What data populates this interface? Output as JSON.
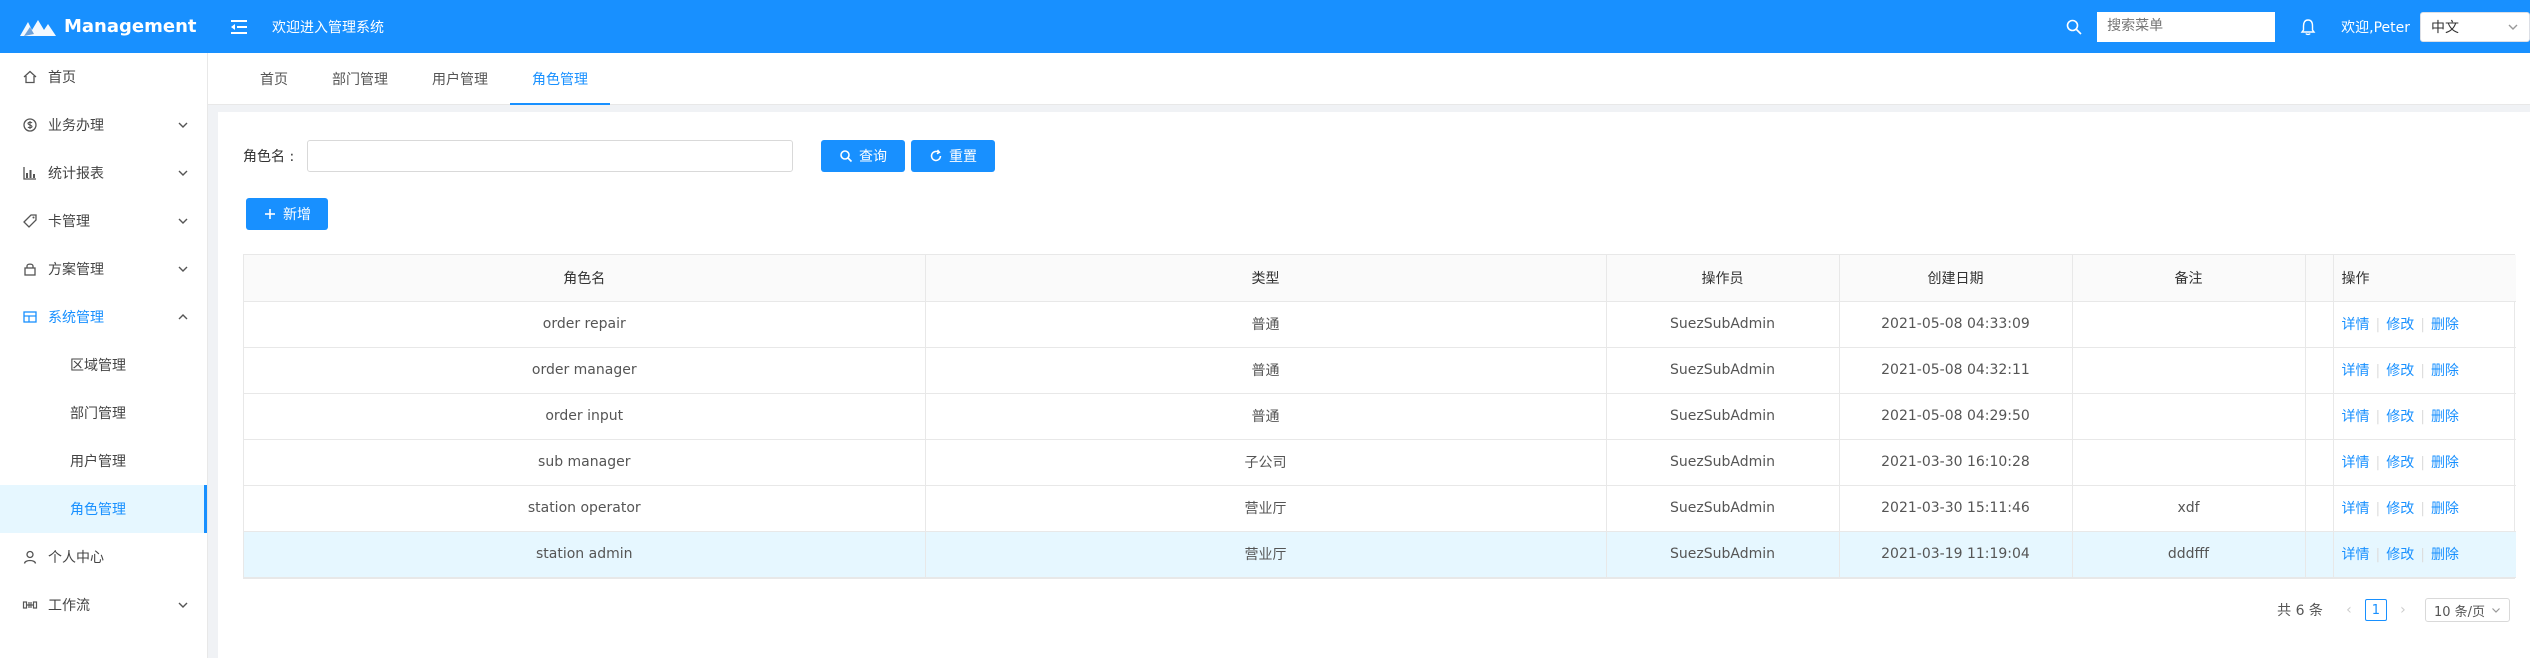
{
  "header": {
    "brand": "Management",
    "welcome_system": "欢迎进入管理系统",
    "search_placeholder": "搜索菜单",
    "user_greeting": "欢迎,Peter",
    "language": "中文"
  },
  "sidebar": {
    "items": [
      {
        "label": "首页",
        "icon": "home-icon"
      },
      {
        "label": "业务办理",
        "icon": "dollar-icon",
        "expandable": true
      },
      {
        "label": "统计报表",
        "icon": "chart-icon",
        "expandable": true
      },
      {
        "label": "卡管理",
        "icon": "card-icon",
        "expandable": true
      },
      {
        "label": "方案管理",
        "icon": "lock-icon",
        "expandable": true
      },
      {
        "label": "系统管理",
        "icon": "system-icon",
        "expandable": true,
        "expanded": true
      },
      {
        "label": "个人中心",
        "icon": "user-icon"
      },
      {
        "label": "工作流",
        "icon": "workflow-icon",
        "expandable": true
      }
    ],
    "sub_items": [
      "区域管理",
      "部门管理",
      "用户管理",
      "角色管理"
    ],
    "selected_sub": "角色管理"
  },
  "tabs": [
    "首页",
    "部门管理",
    "用户管理",
    "角色管理"
  ],
  "active_tab": "角色管理",
  "filter": {
    "label": "角色名 :",
    "value": "",
    "query_label": "查询",
    "reset_label": "重置",
    "add_label": "新增"
  },
  "table": {
    "columns": [
      "角色名",
      "类型",
      "操作员",
      "创建日期",
      "备注",
      "",
      "操作"
    ],
    "rows": [
      {
        "name": "order repair",
        "type": "普通",
        "operator": "SuezSubAdmin",
        "date": "2021-05-08 04:33:09",
        "remark": ""
      },
      {
        "name": "order manager",
        "type": "普通",
        "operator": "SuezSubAdmin",
        "date": "2021-05-08 04:32:11",
        "remark": ""
      },
      {
        "name": "order input",
        "type": "普通",
        "operator": "SuezSubAdmin",
        "date": "2021-05-08 04:29:50",
        "remark": ""
      },
      {
        "name": "sub manager",
        "type": "子公司",
        "operator": "SuezSubAdmin",
        "date": "2021-03-30 16:10:28",
        "remark": ""
      },
      {
        "name": "station operator",
        "type": "营业厅",
        "operator": "SuezSubAdmin",
        "date": "2021-03-30 15:11:46",
        "remark": "xdf"
      },
      {
        "name": "station admin",
        "type": "营业厅",
        "operator": "SuezSubAdmin",
        "date": "2021-03-19 11:19:04",
        "remark": "dddfff"
      }
    ],
    "actions": [
      "详情",
      "修改",
      "删除"
    ],
    "highlighted_row": 5
  },
  "pagination": {
    "total": "共 6 条",
    "current_page": "1",
    "page_size": "10 条/页"
  },
  "colors": {
    "primary": "#1890ff",
    "selected_bg": "#e6f7ff"
  }
}
